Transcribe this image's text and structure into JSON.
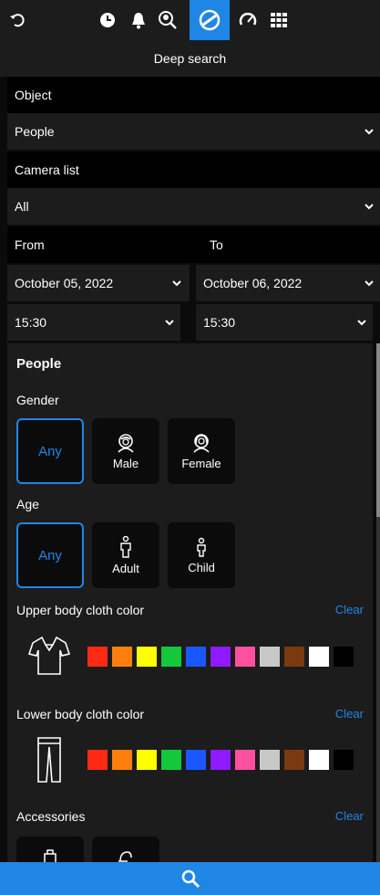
{
  "header": {
    "title": "Deep search",
    "nav_icons": [
      "undo-icon",
      "clock-icon",
      "bell-icon",
      "face-search-icon",
      "deep-search-icon",
      "speedometer-icon",
      "grid-icon"
    ],
    "active_icon": "deep-search-icon"
  },
  "form": {
    "object_label": "Object",
    "object_value": "People",
    "camera_label": "Camera list",
    "camera_value": "All",
    "from_label": "From",
    "to_label": "To",
    "from_date": "October 05, 2022",
    "to_date": "October 06, 2022",
    "from_time": "15:30",
    "to_time": "15:30"
  },
  "people": {
    "title": "People",
    "gender_label": "Gender",
    "gender_options": [
      "Any",
      "Male",
      "Female"
    ],
    "age_label": "Age",
    "age_options": [
      "Any",
      "Adult",
      "Child"
    ],
    "upper_label": "Upper body cloth color",
    "lower_label": "Lower body cloth color",
    "accessories_label": "Accessories",
    "clear_label": "Clear"
  },
  "colors": [
    "#ff2a14",
    "#ff7f0e",
    "#ffff00",
    "#14c83c",
    "#1a57ff",
    "#8f1aff",
    "#ff4fa0",
    "#c8c8c8",
    "#7a3a10",
    "#ffffff",
    "#000000"
  ],
  "accent": "#1f86e6",
  "search_icon": "search-icon"
}
